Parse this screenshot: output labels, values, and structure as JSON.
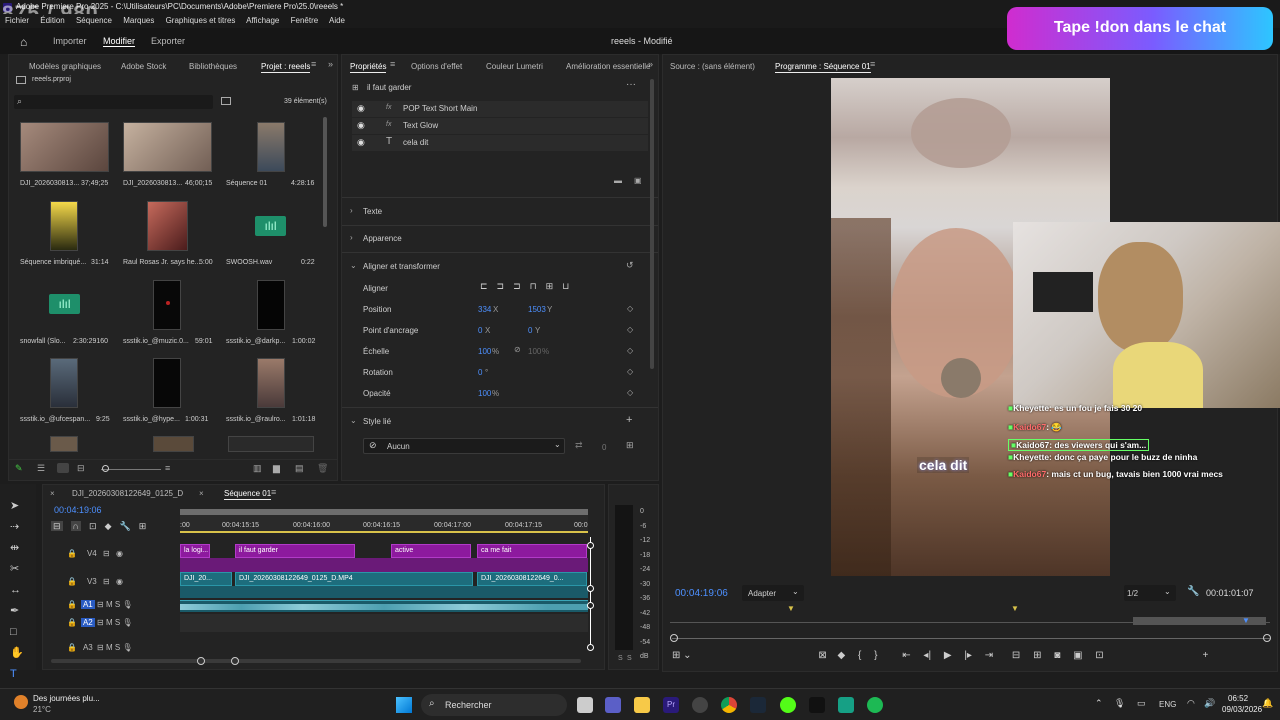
{
  "app": {
    "title": "Adobe Premiere Pro 2025 - C:\\Utilisateurs\\PC\\Documents\\Adobe\\Premiere Pro\\25.0\\reeels *",
    "overlay_counter": "875 / 980"
  },
  "menu": [
    "Fichier",
    "Édition",
    "Séquence",
    "Marques",
    "Graphiques et titres",
    "Affichage",
    "Fenêtre",
    "Aide"
  ],
  "workspace": {
    "tabs": [
      "Importer",
      "Modifier",
      "Exporter"
    ],
    "active": "Modifier",
    "doc_title": "reeels - Modifié"
  },
  "donation_banner": "Tape !don dans le chat",
  "project": {
    "tabs": [
      "Modèles graphiques",
      "Adobe Stock",
      "Bibliothèques",
      "Projet : reeels"
    ],
    "file": "reeels.prproj",
    "count": "39 élément(s)",
    "items": [
      {
        "name": "DJI_2026030813...",
        "dur": "37;49;25"
      },
      {
        "name": "DJI_2026030813...",
        "dur": "46;00;15"
      },
      {
        "name": "Séquence 01",
        "dur": "4:28:16"
      },
      {
        "name": "Séquence imbriqué...",
        "dur": "31:14"
      },
      {
        "name": "Raul Rosas Jr. says he...",
        "dur": "5:00"
      },
      {
        "name": "SWOOSH.wav",
        "dur": "0:22"
      },
      {
        "name": "snowfall (Slo...",
        "dur": "2:30:29160"
      },
      {
        "name": "ssstik.io_@muzic.0...",
        "dur": "59:01"
      },
      {
        "name": "ssstik.io_@darkp...",
        "dur": "1:00:02"
      },
      {
        "name": "ssstik.io_@ufcespan...",
        "dur": "9:25"
      },
      {
        "name": "ssstik.io_@hype...",
        "dur": "1:00:31"
      },
      {
        "name": "ssstik.io_@raulro...",
        "dur": "1:01:18"
      }
    ]
  },
  "properties": {
    "tabs": [
      "Propriétés",
      "Options d'effet",
      "Couleur Lumetri",
      "Amélioration essentielle"
    ],
    "clip_name": "il faut garder",
    "layers": [
      "POP Text Short Main",
      "Text Glow",
      "cela dit"
    ],
    "sections": [
      "Texte",
      "Apparence",
      "Aligner et transformer"
    ],
    "align_label": "Aligner",
    "transform": [
      {
        "label": "Position",
        "v1": "334",
        "u1": "X",
        "v2": "1503",
        "u2": "Y"
      },
      {
        "label": "Point d'ancrage",
        "v1": "0",
        "u1": "X",
        "v2": "0",
        "u2": "Y"
      },
      {
        "label": "Échelle",
        "v1": "100",
        "u1": "%",
        "v2": "100",
        "u2": "%"
      },
      {
        "label": "Rotation",
        "v1": "0",
        "u1": "°",
        "v2": "",
        "u2": ""
      },
      {
        "label": "Opacité",
        "v1": "100",
        "u1": "%",
        "v2": "",
        "u2": ""
      }
    ],
    "style_section": "Style lié",
    "style_value": "Aucun",
    "style_num": "0"
  },
  "program": {
    "tabs": [
      "Source : (sans élément)",
      "Programme : Séquence 01"
    ],
    "timecode": "00:04:19:06",
    "fit": "Adapter",
    "quality": "1/2",
    "duration": "00:01:01:07",
    "caption": "cela dit"
  },
  "chat": [
    {
      "user": "Kheyette",
      "color": "#f0f0f0",
      "msg": ": es un fou je fais 30 20"
    },
    {
      "user": "Kaido67",
      "color": "#ff6b6b",
      "msg": ": 😂"
    },
    {
      "user": "Kaido67",
      "color": "#ff6b6b",
      "msg": ": des viewers qui s'am..."
    },
    {
      "user": "Kheyette",
      "color": "#f0f0f0",
      "msg": ": donc ça paye pour le buzz de ninha"
    },
    {
      "user": "Kaido67",
      "color": "#ff6b6b",
      "msg": ": mais ct un bug, tavais bien 1000 vrai mecs"
    }
  ],
  "timeline": {
    "tabs": [
      "DJI_20260308122649_0125_D",
      "Séquence 01"
    ],
    "timecode": "00:04:19:06",
    "ruler": [
      ":00",
      "00:04:15:15",
      "00:04:16:00",
      "00:04:16:15",
      "00:04:17:00",
      "00:04:17:15",
      "00:0"
    ],
    "tracks": [
      "V4",
      "V3",
      "A1",
      "A2",
      "A3"
    ],
    "v4_clips": [
      "la logi...",
      "il faut garder",
      "active",
      "ca me fait"
    ],
    "v3_clips": [
      "DJI_20...",
      "DJI_20260308122649_0125_D.MP4",
      "DJI_20260308122649_0..."
    ],
    "meter": [
      "0",
      "-6",
      "-12",
      "-18",
      "-24",
      "-30",
      "-36",
      "-42",
      "-48",
      "-54",
      "dB"
    ]
  },
  "taskbar": {
    "weather_title": "Des journées plu...",
    "weather_temp": "21°C",
    "search": "Rechercher",
    "lang": "ENG",
    "time": "06:52",
    "date": "09/03/2026"
  }
}
